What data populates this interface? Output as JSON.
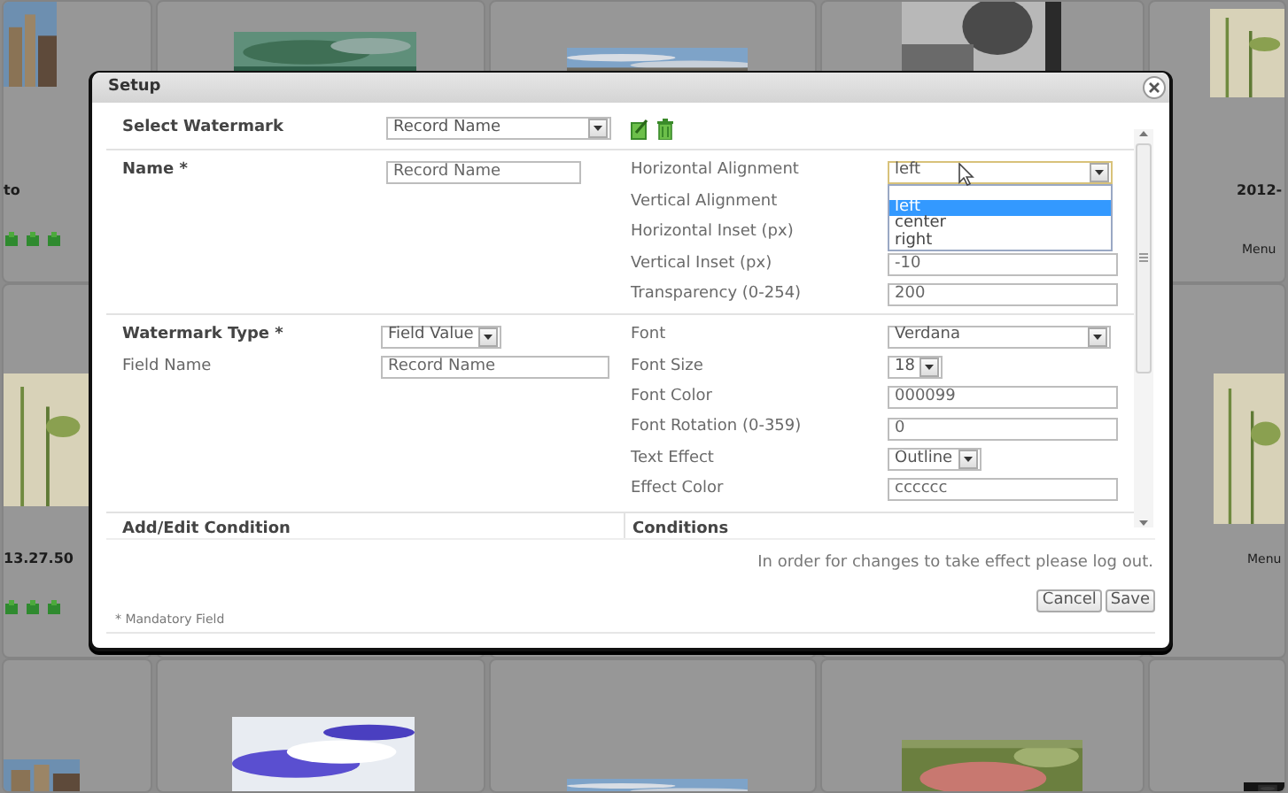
{
  "background": {
    "left_tiles": [
      {
        "caption": "to",
        "icons": true
      },
      {
        "caption": "13.27.50",
        "icons": true
      }
    ],
    "right_tiles": [
      {
        "caption": "2012-",
        "link": "Menu"
      },
      {
        "link": "Menu"
      }
    ]
  },
  "dialog": {
    "title": "Setup",
    "sections": [
      {
        "left": [
          {
            "label": "Select Watermark",
            "bold": true,
            "select": {
              "value": "Record Name"
            }
          }
        ],
        "right": [
          {
            "kind": "tools"
          }
        ]
      },
      {
        "left": [
          {
            "label": "Name *",
            "bold": true,
            "input": {
              "value": "Record Name"
            }
          }
        ],
        "right": [
          {
            "kind": "field",
            "label": "Horizontal Alignment",
            "select": {
              "value": "left",
              "focused": true,
              "open": true,
              "options": [
                {
                  "label": "left",
                  "selected": true
                },
                {
                  "label": "center",
                  "selected": false
                },
                {
                  "label": "right",
                  "selected": false
                }
              ]
            }
          },
          {
            "kind": "field",
            "label": "Vertical Alignment"
          },
          {
            "kind": "field",
            "label": "Horizontal Inset (px)"
          },
          {
            "kind": "field",
            "label": "Vertical Inset (px)",
            "input": {
              "value": "-10"
            }
          },
          {
            "kind": "field",
            "label": "Transparency (0-254)",
            "input": {
              "value": "200"
            }
          }
        ]
      },
      {
        "left": [
          {
            "label": "Watermark Type *",
            "bold": true,
            "select": {
              "value": "Field Value"
            }
          },
          {
            "label": "Field Name",
            "bold": false,
            "input": {
              "value": "Record Name"
            }
          }
        ],
        "right": [
          {
            "kind": "field",
            "label": "Font",
            "select": {
              "value": "Verdana"
            }
          },
          {
            "kind": "field",
            "label": "Font Size",
            "select": {
              "value": "18"
            }
          },
          {
            "kind": "field",
            "label": "Font Color",
            "input": {
              "value": "000099"
            }
          },
          {
            "kind": "field",
            "label": "Font Rotation (0-359)",
            "input": {
              "value": "0"
            }
          },
          {
            "kind": "field",
            "label": "Text Effect",
            "select": {
              "value": "Outline"
            }
          },
          {
            "kind": "field",
            "label": "Effect Color",
            "input": {
              "value": "cccccc"
            }
          }
        ]
      }
    ],
    "conditions": {
      "left": "Add/Edit Condition",
      "right": "Conditions"
    },
    "notice": "In order for changes to take effect please log out.",
    "buttons": [
      {
        "label": "Cancel"
      },
      {
        "label": "Save"
      }
    ],
    "footnote": "* Mandatory Field"
  }
}
